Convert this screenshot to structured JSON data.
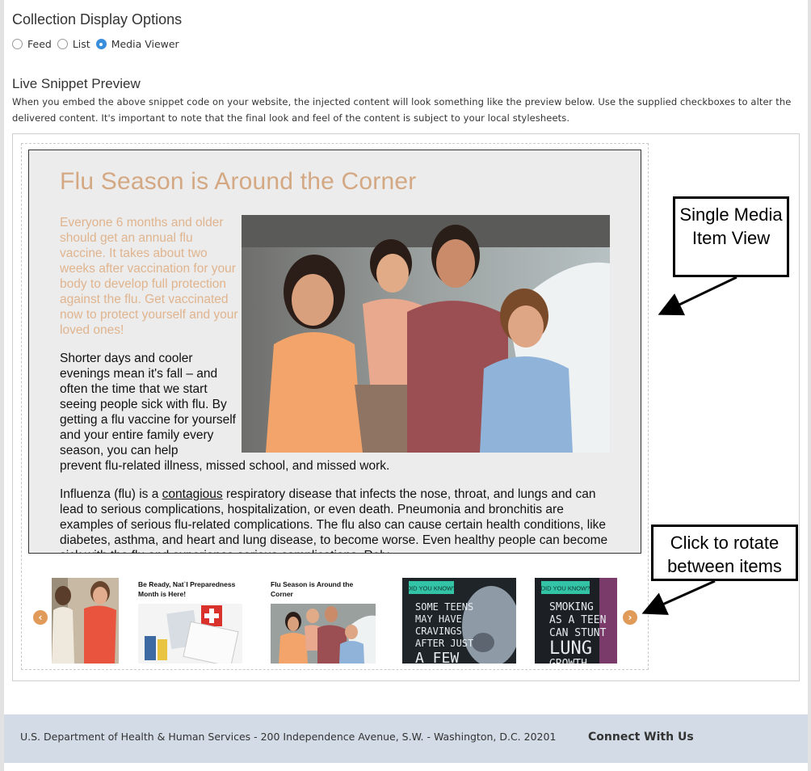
{
  "display_options": {
    "title": "Collection Display Options",
    "options": [
      {
        "label": "Feed",
        "checked": false
      },
      {
        "label": "List",
        "checked": false
      },
      {
        "label": "Media Viewer",
        "checked": true
      }
    ]
  },
  "preview": {
    "title": "Live Snippet Preview",
    "description": "When you embed the above snippet code on your website, the injected content will look something like the preview below. Use the supplied checkboxes to alter the delivered content. It's important to note that the final look and feel of the content is subject to your local stylesheets."
  },
  "media_item": {
    "title": "Flu Season is Around the Corner",
    "lead": "Everyone 6 months and older should get an annual flu vaccine. It takes about two weeks after vaccination for your body to develop full protection against the flu. Get vaccinated now to protect yourself and your loved ones!",
    "para1": "Shorter days and cooler evenings mean it's fall – and often the time that we start seeing people sick with flu.  By getting a flu vaccine for yourself and your entire family every season, you can help",
    "para1_end": "prevent flu-related illness, missed school, and missed work.",
    "para2_before": "Influenza (flu) is a ",
    "para2_link": "contagious",
    "para2_after": " respiratory disease that infects the nose, throat, and lungs and can lead to serious complications, hospitalization, or even death. Pneumonia and bronchitis are examples of serious flu-related complications. The flu also can cause certain health conditions, like diabetes, asthma, and heart and lung disease, to become worse. Even healthy people can become sick with the flu and experience serious complications. Rely"
  },
  "carousel": {
    "prev_icon": "chevron-left-icon",
    "next_icon": "chevron-right-icon",
    "items": [
      {
        "caption": ""
      },
      {
        "caption": "Be Ready, Nat`l Preparedness Month is Here!"
      },
      {
        "caption": "Flu Season is Around the Corner"
      },
      {
        "caption": "",
        "badge": "DID YOU KNOW?",
        "text": "SOME TEENS MAY HAVE CRAVINGS AFTER JUST A FEW"
      },
      {
        "caption": "",
        "badge": "DID YOU KNOW?",
        "text": "SMOKING AS A TEEN CAN STUNT LUNG GROWTH"
      }
    ]
  },
  "callouts": {
    "single": "Single Media Item View",
    "rotate": "Click to rotate between items"
  },
  "footer": {
    "address": "U.S. Department of Health & Human Services - 200 Independence Avenue, S.W. - Washington, D.C. 20201",
    "connect": "Connect With Us"
  },
  "colors": {
    "accent_radio": "#3a8fdc",
    "title_tan": "#d3a883",
    "arrow_orange": "#e09b5a",
    "footer_bg": "#d2dbe6"
  }
}
